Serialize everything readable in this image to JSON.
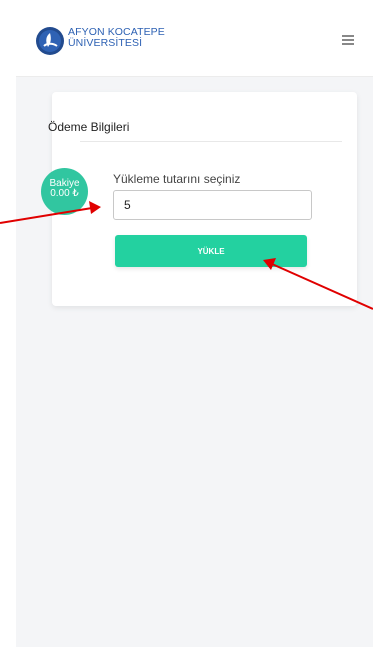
{
  "header": {
    "brand_line_1": "AFYON KOCATEPE",
    "brand_line_2": "ÜNİVERSİTESİ",
    "logo_icon": "university-emblem-icon",
    "menu_icon": "hamburger-menu-icon"
  },
  "payment_card": {
    "title": "Ödeme Bilgileri",
    "amount_label": "Yükleme tutarını seçiniz",
    "amount_value": "5",
    "submit_label": "YÜKLE"
  },
  "balance_badge": {
    "label": "Bakiye",
    "value": "0.00 ₺"
  },
  "annotation_arrows": {
    "icon": "arrow-icon",
    "color": "#e00000"
  },
  "colors": {
    "brand_blue": "#2d61b3",
    "accent_green": "#23d1a0",
    "badge_green": "#31c6a0",
    "page_bg": "#f4f5f7"
  }
}
